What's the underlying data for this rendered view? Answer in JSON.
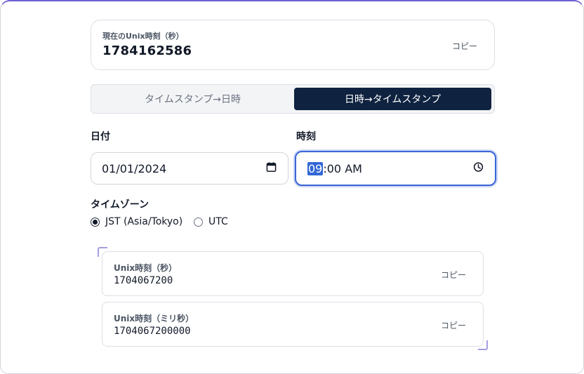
{
  "current": {
    "label": "現在のUnix時刻（秒）",
    "value": "1784162586",
    "copy_label": "コピー"
  },
  "tabs": [
    {
      "label": "タイムスタンプ→日時",
      "active": false
    },
    {
      "label": "日時→タイムスタンプ",
      "active": true
    }
  ],
  "date_field": {
    "label": "日付",
    "value": "01/01/2024",
    "icon": "calendar-icon"
  },
  "time_field": {
    "label": "時刻",
    "hour": "09",
    "rest": ":00 AM",
    "icon": "clock-icon"
  },
  "timezone": {
    "label": "タイムゾーン",
    "options": [
      {
        "label": "JST (Asia/Tokyo)",
        "checked": true
      },
      {
        "label": "UTC",
        "checked": false
      }
    ]
  },
  "results": [
    {
      "label": "Unix時刻（秒）",
      "value": "1704067200",
      "copy_label": "コピー"
    },
    {
      "label": "Unix時刻（ミリ秒）",
      "value": "1704067200000",
      "copy_label": "コピー"
    }
  ],
  "colors": {
    "accent": "#0f2340",
    "focus": "#3b66d6",
    "frame_top": "#6d5fd1",
    "corner": "#a59fe0"
  }
}
